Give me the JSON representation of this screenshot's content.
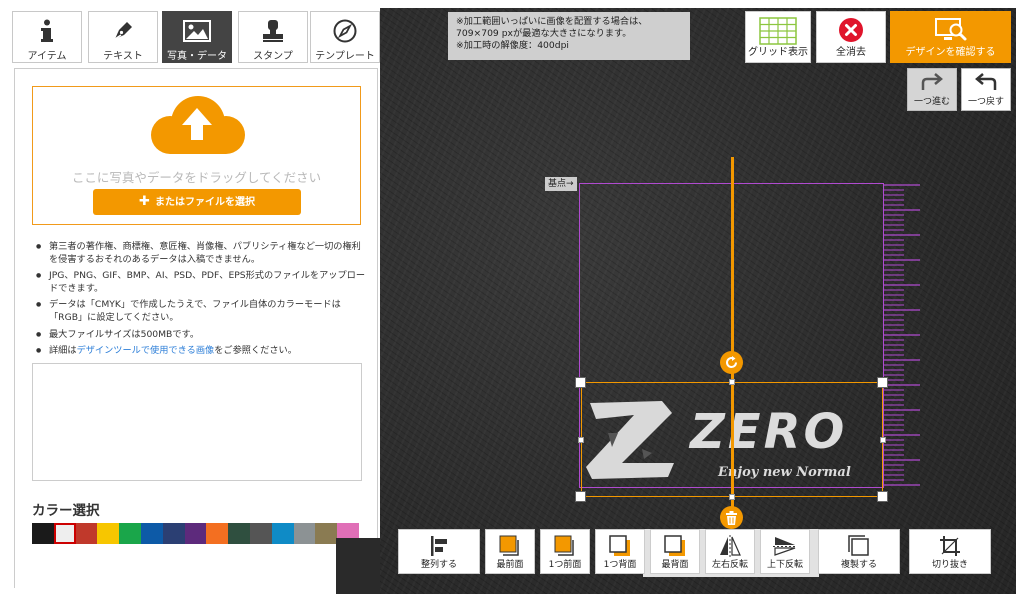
{
  "tabs": [
    {
      "label": "アイテム",
      "icon": "info-icon",
      "active": false
    },
    {
      "label": "テキスト",
      "icon": "pen-icon",
      "active": false
    },
    {
      "label": "写真・データ",
      "icon": "image-icon",
      "active": true
    },
    {
      "label": "スタンプ",
      "icon": "stamp-icon",
      "active": false
    },
    {
      "label": "テンプレート",
      "icon": "compass-icon",
      "active": false
    }
  ],
  "upload": {
    "drop_text": "ここに写真やデータをドラッグしてください",
    "file_button": "またはファイルを選択",
    "cloud_icon": "cloud-upload-icon"
  },
  "notes": {
    "n1": "第三者の著作権、商標権、意匠権、肖像権、パブリシティ権など一切の権利を侵害するおそれのあるデータは入稿できません。",
    "n2": "JPG、PNG、GIF、BMP、AI、PSD、PDF、EPS形式のファイルをアップロードできます。",
    "n3": "データは「CMYK」で作成したうえで、ファイル自体のカラーモードは「RGB」に設定してください。",
    "n4": "最大ファイルサイズは500MBです。",
    "n5_prefix": "詳細は",
    "n5_link": "デザインツールで使用できる画像",
    "n5_suffix": "をご参照ください。"
  },
  "color_section": {
    "title": "カラー選択",
    "swatches": [
      "#1a1a1a",
      "#eeeeee",
      "#c0392b",
      "#f7c600",
      "#1aa64a",
      "#0d5aa7",
      "#2b3f73",
      "#5d2a7c",
      "#f36f21",
      "#2f4f3f",
      "#555555",
      "#0f8bc6",
      "#8c9294",
      "#8a7b52",
      "#e06fb7"
    ],
    "selected_index": 1
  },
  "notice": {
    "line1": "※加工範囲いっぱいに画像を配置する場合は、",
    "line2": "709×709 pxが最適な大きさになります。",
    "line3": "※加工時の解像度：400dpi"
  },
  "top_buttons": {
    "grid": "グリッド表示",
    "clear": "全消去",
    "confirm": "デザインを確認する"
  },
  "history": {
    "redo": "一つ進む",
    "undo": "一つ戻す"
  },
  "canvas": {
    "base_label": "基点→",
    "logo_text": "ZERO",
    "logo_subtext": "Enjoy new Normal"
  },
  "toolbar": {
    "align": "整列する",
    "front_most": "最前面",
    "forward": "1つ前面",
    "backward": "1つ背面",
    "back_most": "最背面",
    "flip_h": "左右反転",
    "flip_v": "上下反転",
    "duplicate": "複製する",
    "crop": "切り抜き"
  },
  "colors": {
    "accent": "#f39800",
    "guide": "#b04bd0",
    "canvas_bg": "#2f2f2f"
  }
}
